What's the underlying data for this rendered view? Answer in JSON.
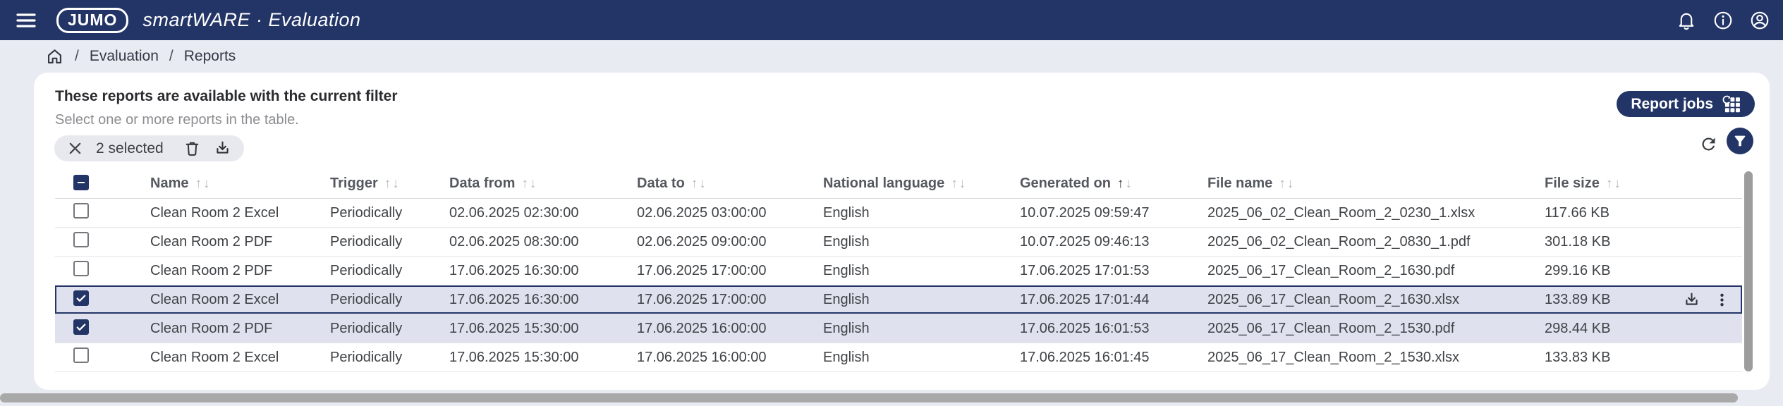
{
  "colors": {
    "navy": "#233567",
    "page_bg": "#e9ebf3",
    "selected_row_bg": "#dfe2ee",
    "card_bg": "#ffffff"
  },
  "topbar": {
    "logo_text": "JUMO",
    "app_title": "smartWARE · Evaluation",
    "icons": [
      "menu-icon",
      "bell-icon",
      "info-icon",
      "account-icon"
    ]
  },
  "breadcrumb": {
    "separator": "/",
    "items": [
      "Evaluation",
      "Reports"
    ],
    "home_icon": "home-icon"
  },
  "panel": {
    "title": "These reports are available with the current filter",
    "subtitle": "Select one or more reports in the table.",
    "report_jobs_label": "Report jobs",
    "report_jobs_icon": "grid-refresh-icon",
    "selected_label": "2 selected",
    "chip_icons": [
      "close-icon",
      "trash-icon",
      "download-icon"
    ],
    "action_icons": [
      "refresh-icon",
      "filter-icon"
    ]
  },
  "table": {
    "sort_up": "↑",
    "sort_down": "↓",
    "header_checkbox_state": "indeterminate",
    "columns": [
      {
        "label": "Name",
        "sorted": null
      },
      {
        "label": "Trigger",
        "sorted": null
      },
      {
        "label": "Data from",
        "sorted": null
      },
      {
        "label": "Data to",
        "sorted": null
      },
      {
        "label": "National language",
        "sorted": null
      },
      {
        "label": "Generated on",
        "sorted": "asc"
      },
      {
        "label": "File name",
        "sorted": null
      },
      {
        "label": "File size",
        "sorted": null
      }
    ],
    "rows": [
      {
        "checked": false,
        "focused": false,
        "show_actions": false,
        "name": "Clean Room 2 Excel",
        "trigger": "Periodically",
        "data_from": "02.06.2025 02:30:00",
        "data_to": "02.06.2025 03:00:00",
        "language": "English",
        "generated_on": "10.07.2025 09:59:47",
        "file_name": "2025_06_02_Clean_Room_2_0230_1.xlsx",
        "file_size": "117.66 KB"
      },
      {
        "checked": false,
        "focused": false,
        "show_actions": false,
        "name": "Clean Room 2 PDF",
        "trigger": "Periodically",
        "data_from": "02.06.2025 08:30:00",
        "data_to": "02.06.2025 09:00:00",
        "language": "English",
        "generated_on": "10.07.2025 09:46:13",
        "file_name": "2025_06_02_Clean_Room_2_0830_1.pdf",
        "file_size": "301.18 KB"
      },
      {
        "checked": false,
        "focused": false,
        "show_actions": false,
        "name": "Clean Room 2 PDF",
        "trigger": "Periodically",
        "data_from": "17.06.2025 16:30:00",
        "data_to": "17.06.2025 17:00:00",
        "language": "English",
        "generated_on": "17.06.2025 17:01:53",
        "file_name": "2025_06_17_Clean_Room_2_1630.pdf",
        "file_size": "299.16 KB"
      },
      {
        "checked": true,
        "focused": true,
        "show_actions": true,
        "name": "Clean Room 2 Excel",
        "trigger": "Periodically",
        "data_from": "17.06.2025 16:30:00",
        "data_to": "17.06.2025 17:00:00",
        "language": "English",
        "generated_on": "17.06.2025 17:01:44",
        "file_name": "2025_06_17_Clean_Room_2_1630.xlsx",
        "file_size": "133.89 KB"
      },
      {
        "checked": true,
        "focused": false,
        "show_actions": false,
        "name": "Clean Room 2 PDF",
        "trigger": "Periodically",
        "data_from": "17.06.2025 15:30:00",
        "data_to": "17.06.2025 16:00:00",
        "language": "English",
        "generated_on": "17.06.2025 16:01:53",
        "file_name": "2025_06_17_Clean_Room_2_1530.pdf",
        "file_size": "298.44 KB"
      },
      {
        "checked": false,
        "focused": false,
        "show_actions": false,
        "name": "Clean Room 2 Excel",
        "trigger": "Periodically",
        "data_from": "17.06.2025 15:30:00",
        "data_to": "17.06.2025 16:00:00",
        "language": "English",
        "generated_on": "17.06.2025 16:01:45",
        "file_name": "2025_06_17_Clean_Room_2_1530.xlsx",
        "file_size": "133.83 KB"
      }
    ]
  }
}
